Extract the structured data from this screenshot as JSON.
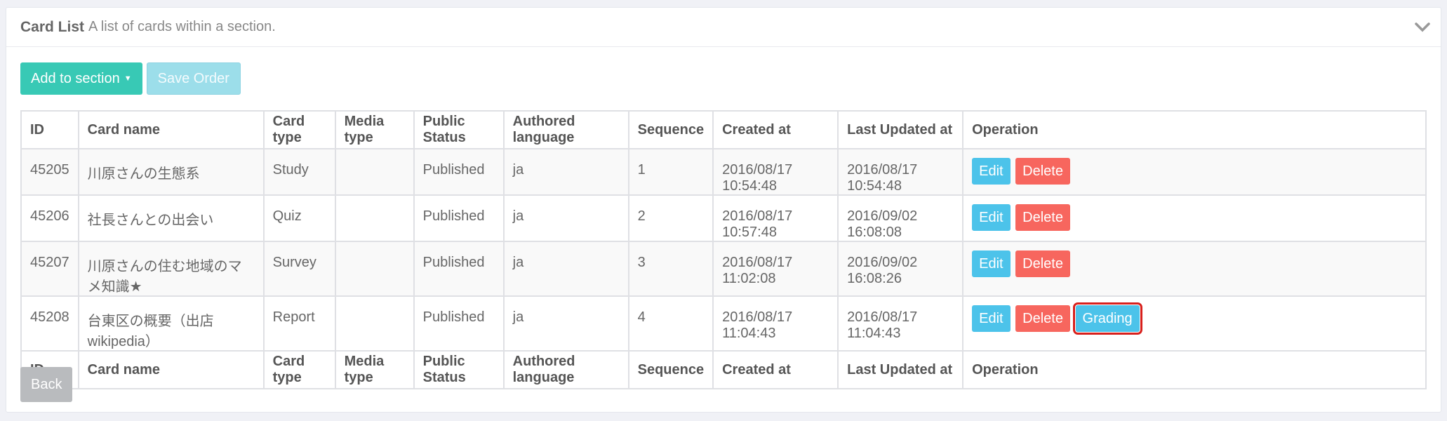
{
  "header": {
    "title": "Card List",
    "subtitle": "A list of cards within a section."
  },
  "toolbar": {
    "add_label": "Add to section",
    "save_label": "Save Order"
  },
  "table": {
    "columns": [
      "ID",
      "Card name",
      "Card type",
      "Media type",
      "Public Status",
      "Authored language",
      "Sequence",
      "Created at",
      "Last Updated at",
      "Operation"
    ],
    "rows": [
      {
        "id": "45205",
        "name": "川原さんの生態系",
        "type": "Study",
        "media": "",
        "status": "Published",
        "lang": "ja",
        "seq": "1",
        "created": "2016/08/17 10:54:48",
        "updated": "2016/08/17 10:54:48"
      },
      {
        "id": "45206",
        "name": "社長さんとの出会い",
        "type": "Quiz",
        "media": "",
        "status": "Published",
        "lang": "ja",
        "seq": "2",
        "created": "2016/08/17 10:57:48",
        "updated": "2016/09/02 16:08:08"
      },
      {
        "id": "45207",
        "name": "川原さんの住む地域のマメ知識★",
        "type": "Survey",
        "media": "",
        "status": "Published",
        "lang": "ja",
        "seq": "3",
        "created": "2016/08/17 11:02:08",
        "updated": "2016/09/02 16:08:26"
      },
      {
        "id": "45208",
        "name": "台東区の概要（出店 wikipedia）",
        "type": "Report",
        "media": "",
        "status": "Published",
        "lang": "ja",
        "seq": "4",
        "created": "2016/08/17 11:04:43",
        "updated": "2016/08/17 11:04:43"
      }
    ],
    "ops": {
      "edit": "Edit",
      "delete": "Delete",
      "grading": "Grading"
    }
  },
  "footer": {
    "back_label": "Back"
  },
  "icons": {
    "collapse": "chevron-down-icon"
  },
  "colors": {
    "teal": "#38c9b5",
    "edit": "#4cc3ea",
    "delete": "#f7665e",
    "highlight": "#d8201c"
  }
}
